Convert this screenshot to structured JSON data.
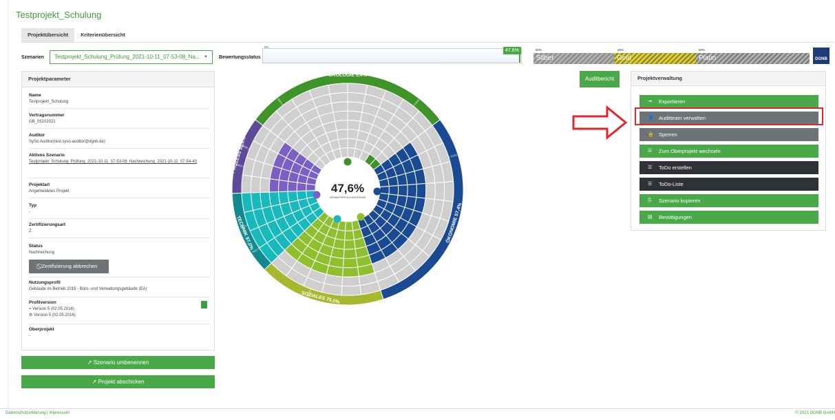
{
  "title": "Testprojekt_Schulung",
  "tabs": [
    "Projektübersicht",
    "Kriterienübersicht"
  ],
  "scenario": {
    "label": "Szenarien",
    "value": "Testprojekt_Schulung_Prüfung_2021-10-11_07-53-08_Na..."
  },
  "rating": {
    "label": "Bewertungsstatus",
    "progress_percent": 47.6,
    "progress_label": "47.6%",
    "scale_start": "0%",
    "tiers": [
      {
        "name": "Silber",
        "threshold": "50%"
      },
      {
        "name": "Gold",
        "threshold": "65%"
      },
      {
        "name": "Platin",
        "threshold": "80%"
      }
    ],
    "logo_text": "DGNB"
  },
  "params": {
    "header": "Projektparameter",
    "fields": [
      {
        "label": "Name",
        "value": "Testprojekt_Schulung"
      },
      {
        "label": "Vertragsnummer",
        "value": "GB_05102021"
      },
      {
        "label": "Auditor",
        "value": "SySo.Auditor(test.syso-auditor@dgnb.de)"
      },
      {
        "label": "Aktives Szenario",
        "value": "Testprojekt_Schulung_Prüfung_2021-10-11_07-53-08_Nachreichung_2021-10-11_07-54-40"
      },
      {
        "label": "Projektart",
        "value": "Angemeldetes Projekt"
      },
      {
        "label": "Typ",
        "value": "-"
      },
      {
        "label": "Zertifizierungsart",
        "value": "Z"
      },
      {
        "label": "Status",
        "value": "Nachreichung"
      },
      {
        "label": "Nutzungsprofil",
        "value": "Gebäude im Betrieb 2015 - Büro- und Verwaltungsgebäude (EA)"
      },
      {
        "label": "Profilversion",
        "value": "Version 5 (02.05.2016)",
        "value2": "Version 5 (02.05.2016)"
      },
      {
        "label": "Oberprojekt",
        "value": "-"
      }
    ],
    "cancel_button": "Zertifizierung abbrechen"
  },
  "actions": {
    "rename": "Szenario umbenennen",
    "submit": "Projekt abschicken",
    "audit_report": "Auditbericht"
  },
  "chart": {
    "center_value": "47,6%",
    "center_label": "GESAMTERFÜLLUNGSGRAD",
    "sectors": [
      {
        "name": "ÖKOLOGIE",
        "value": "8,4%",
        "color": "#3f9429"
      },
      {
        "name": "ÖKONOMIE",
        "value": "57,4%",
        "color": "#1a4a92"
      },
      {
        "name": "SOZIALES",
        "value": "75,0%",
        "color": "#8dbf2f"
      },
      {
        "name": "TECHNIK",
        "value": "97,0%",
        "color": "#18b9bd"
      },
      {
        "name": "PROZESS",
        "value": "55,0%",
        "color": "#7a5fc5"
      }
    ],
    "small_labels": [
      "ENV1.1",
      "ENV1.2",
      "ECO1.1",
      "SOC1.1",
      "TEC1.1",
      "TEC1.3",
      "PRO1.1",
      "PRO2.2"
    ]
  },
  "verwaltung": {
    "header": "Projektverwaltung",
    "buttons": [
      {
        "label": "Exportieren",
        "icon": "export-icon"
      },
      {
        "label": "Auditteam verwalten",
        "icon": "user-plus-icon"
      },
      {
        "label": "Sperren",
        "icon": "lock-icon"
      },
      {
        "label": "Zum Oberprojekt wechseln",
        "icon": "list-icon"
      },
      {
        "label": "ToDo erstellen",
        "icon": "list-icon"
      },
      {
        "label": "ToDo-Liste",
        "icon": "list-icon"
      },
      {
        "label": "Szenario kopieren",
        "icon": "copy-icon"
      },
      {
        "label": "Bestätigungen",
        "icon": "document-icon"
      }
    ]
  },
  "footer": {
    "left": "Datenschutzerklärung | Impressum",
    "right": "© 2021 DGNB GmbH"
  }
}
